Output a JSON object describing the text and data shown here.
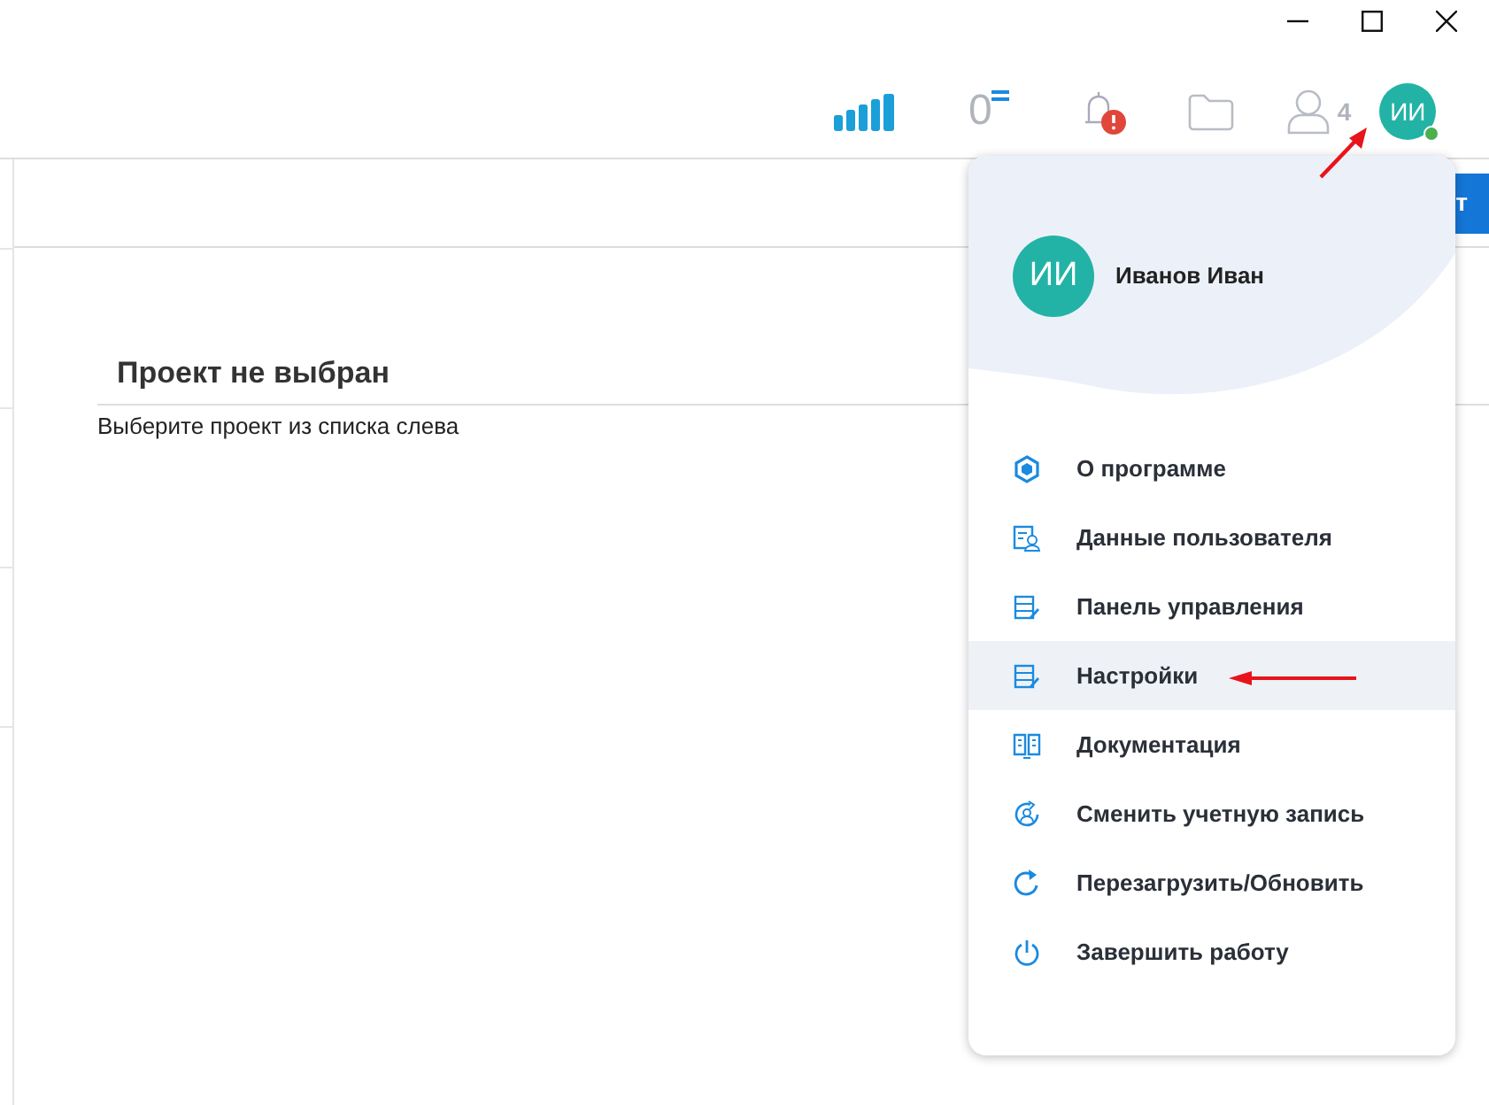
{
  "toolbar": {
    "queue_count": "0",
    "users_count": "4",
    "avatar_initials": "ИИ",
    "online": true,
    "alert": true
  },
  "header_button": {
    "label": "т"
  },
  "content": {
    "title": "Проект не выбран",
    "message": "Выберите проект из списка слева"
  },
  "user_menu": {
    "avatar_initials": "ИИ",
    "user_name": "Иванов Иван",
    "items": [
      {
        "kind": "about",
        "label": "О программе",
        "selected": false
      },
      {
        "kind": "user",
        "label": "Данные пользователя",
        "selected": false
      },
      {
        "kind": "panel",
        "label": "Панель управления",
        "selected": false
      },
      {
        "kind": "panel",
        "label": "Настройки",
        "selected": true
      },
      {
        "kind": "docs",
        "label": "Документация",
        "selected": false
      },
      {
        "kind": "switch",
        "label": "Сменить учетную запись",
        "selected": false
      },
      {
        "kind": "reload",
        "label": "Перезагрузить/Обновить",
        "selected": false
      },
      {
        "kind": "power",
        "label": "Завершить работу",
        "selected": false
      }
    ]
  }
}
